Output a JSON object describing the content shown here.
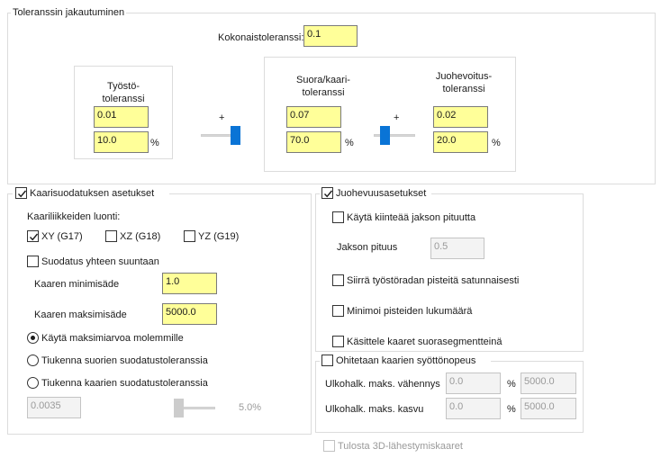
{
  "tolerance": {
    "legend": "Toleranssin jakautuminen",
    "total_label": "Kokonaistoleranssi:",
    "total_value": "0.1",
    "machining_label": "Työstö-\ntoleranssi",
    "machining_value": "0.01",
    "machining_percent": "10.0",
    "line_arc_label": "Suora/kaari-\ntoleranssi",
    "line_arc_value": "0.07",
    "line_arc_percent": "70.0",
    "smoothing_label": "Juohevoitus-\ntoleranssi",
    "smoothing_value": "0.02",
    "smoothing_percent": "20.0",
    "percent_sign": "%",
    "plus_sign": "+",
    "slider1_percent": 10,
    "slider2_percent": 70
  },
  "arc_filter": {
    "legend": "Kaarisuodatuksen asetukset",
    "checked": true,
    "arc_moves_label": "Kaariliikkeiden luonti:",
    "planes": [
      {
        "label": "XY (G17)",
        "checked": true
      },
      {
        "label": "XZ (G18)",
        "checked": false
      },
      {
        "label": "YZ (G19)",
        "checked": false
      }
    ],
    "one_direction_label": "Suodatus yhteen suuntaan",
    "one_direction_checked": false,
    "min_side_label": "Kaaren minimisäde",
    "min_side_value": "1.0",
    "max_side_label": "Kaaren maksimisäde",
    "max_side_value": "5000.0",
    "radio_options": [
      {
        "label": "Käytä maksimiarvoa molemmille",
        "selected": true
      },
      {
        "label": "Tiukenna suorien suodatustoleranssia",
        "selected": false
      },
      {
        "label": "Tiukenna kaarien suodatustoleranssia",
        "selected": false
      }
    ],
    "bottom_value": "0.0035",
    "bottom_percent": "5.0%",
    "bottom_slider_percent": 5
  },
  "smoothing": {
    "legend": "Juohevuusasetukset",
    "checked": true,
    "fixed_interval_label": "Käytä kiinteää jakson pituutta",
    "fixed_interval_checked": false,
    "interval_length_label": "Jakson pituus",
    "interval_length_value": "0.5",
    "move_points_label": "Siirrä työstöradan pisteitä satunnaisesti",
    "move_points_checked": false,
    "minimize_points_label": "Minimoi pisteiden lukumäärä",
    "minimize_points_checked": false,
    "treat_arcs_label": "Käsittele kaaret suorasegmentteinä",
    "treat_arcs_checked": false
  },
  "feedrate": {
    "legend": "Ohitetaan kaarien syöttönopeus",
    "checked": false,
    "decrease_label": "Ulkohalk. maks. vähennys",
    "decrease_value": "0.0",
    "decrease_max": "5000.0",
    "increase_label": "Ulkohalk. maks. kasvu",
    "increase_value": "0.0",
    "increase_max": "5000.0",
    "percent_sign": "%"
  },
  "output_3d": {
    "label": "Tulosta 3D-lähestymiskaaret",
    "checked": false
  }
}
